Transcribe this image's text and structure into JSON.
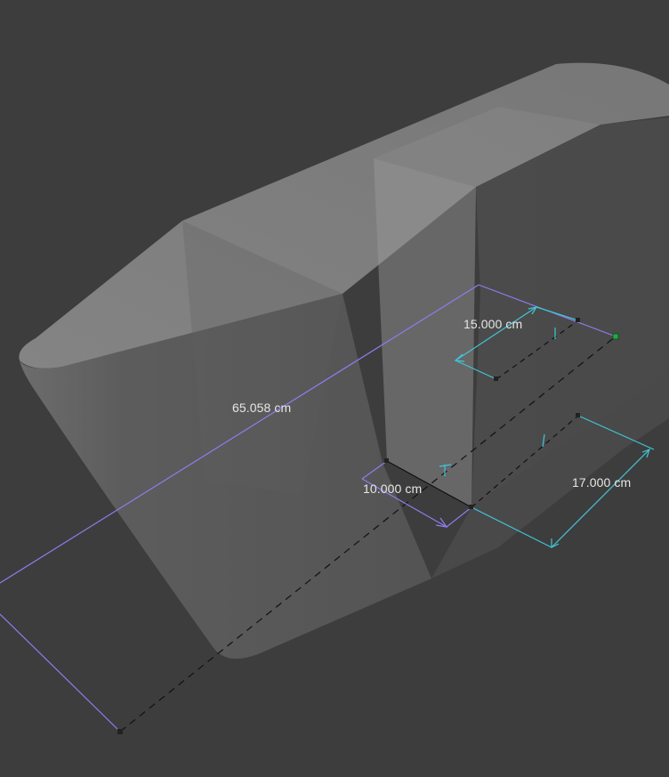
{
  "viewport": {
    "background": "#3d3d3d"
  },
  "model": {
    "face_color": "#7a7a7a",
    "edge_color": "#111111"
  },
  "measurements": {
    "total_length": "65.058 cm",
    "depth": "15.000 cm",
    "width": "10.000 cm",
    "height": "17.000 cm"
  },
  "colors": {
    "purple_dimension": "#8f7cf0",
    "cyan_dimension": "#3fc6d6",
    "label_text": "#e6e6e6",
    "snap_point": "#22aa44"
  }
}
